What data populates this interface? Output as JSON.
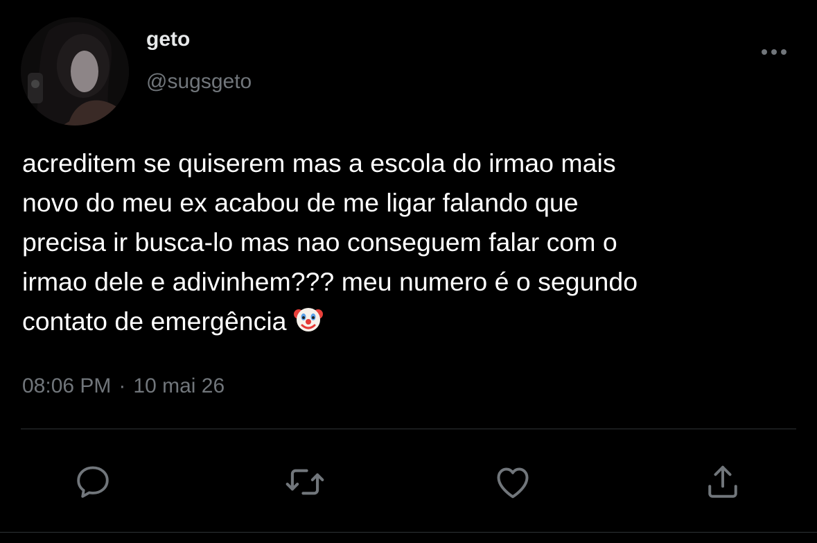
{
  "tweet": {
    "author": {
      "display_name": "geto",
      "handle": "@sugsgeto"
    },
    "text": "acreditem se quiserem mas a escola do irmao mais\nnovo do meu ex acabou de me ligar falando que\nprecisa ir busca-lo mas nao conseguem falar com o\nirmao dele e adivinhem??? meu numero é o segundo\ncontato de emergência",
    "emoji": "clown-face-emoji",
    "time": "08:06 PM",
    "separator": "·",
    "date": "10 mai 26"
  },
  "icons": {
    "more": "more-horizontal-icon",
    "reply": "reply-bubble-icon",
    "retweet": "retweet-icon",
    "like": "heart-icon",
    "share": "share-upload-icon"
  },
  "colors": {
    "background": "#000000",
    "primary_text": "#ffffff",
    "secondary_text": "#71767b",
    "divider": "#2f3336",
    "icon": "#71767b"
  }
}
